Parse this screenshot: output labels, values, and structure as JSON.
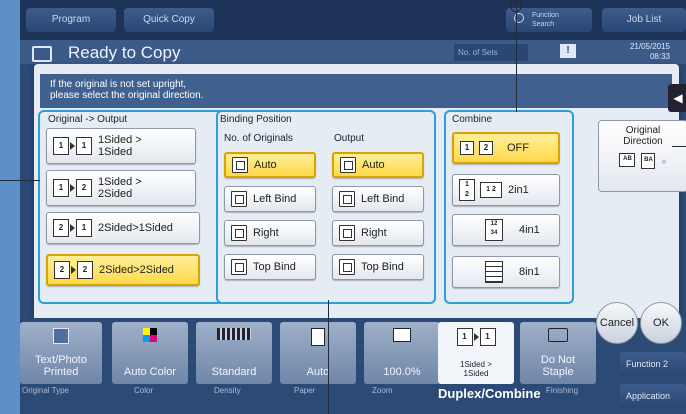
{
  "topbar": {
    "program": "Program",
    "quick_copy": "Quick Copy",
    "function_search_line1": "Function",
    "function_search_line2": "Search",
    "job_list": "Job List"
  },
  "status": {
    "title": "Ready to Copy",
    "sets_label": "No. of Sets",
    "warning": "!",
    "date": "21/05/2015",
    "time": "08:33"
  },
  "dialog": {
    "instruction_line1": "If the original is not set upright,",
    "instruction_line2": "please select the original direction.",
    "original_output": {
      "title": "Original -> Output",
      "options": [
        {
          "label": "1Sided >\n1Sided",
          "icon": "1-to-1-sided-icon",
          "selected": false
        },
        {
          "label": "1Sided >\n2Sided",
          "icon": "1-to-2-sided-icon",
          "selected": false
        },
        {
          "label": "2Sided>1Sided",
          "icon": "2-to-1-sided-icon",
          "selected": false
        },
        {
          "label": "2Sided>2Sided",
          "icon": "2-to-2-sided-icon",
          "selected": true
        }
      ]
    },
    "binding_position": {
      "title": "Binding Position",
      "originals_title": "No. of Originals",
      "output_title": "Output",
      "originals": [
        {
          "label": "Auto",
          "selected": true
        },
        {
          "label": "Left Bind",
          "selected": false
        },
        {
          "label": "Right",
          "selected": false
        },
        {
          "label": "Top Bind",
          "selected": false
        }
      ],
      "output": [
        {
          "label": "Auto",
          "selected": true
        },
        {
          "label": "Left Bind",
          "selected": false
        },
        {
          "label": "Right",
          "selected": false
        },
        {
          "label": "Top Bind",
          "selected": false
        }
      ]
    },
    "combine": {
      "title": "Combine",
      "options": [
        {
          "label": "OFF",
          "selected": true
        },
        {
          "label": "2in1",
          "selected": false
        },
        {
          "label": "4in1",
          "selected": false
        },
        {
          "label": "8in1",
          "selected": false
        }
      ]
    },
    "original_direction": {
      "line1": "Original",
      "line2": "Direction"
    }
  },
  "actions": {
    "cancel": "Cancel",
    "ok": "OK"
  },
  "bottom": {
    "tiles": [
      {
        "text": "Text/Photo\nPrinted",
        "caption": "Original Type"
      },
      {
        "text": "Auto Color",
        "caption": "Color"
      },
      {
        "text": "Standard",
        "caption": "Density"
      },
      {
        "text": "Auto",
        "caption": "Paper"
      },
      {
        "text": "100.0%",
        "caption": "Zoom"
      },
      {
        "text": "1Sided >\n1Sided",
        "caption": "Duplex/Combine"
      },
      {
        "text": "Do Not\nStaple",
        "caption": "Finishing"
      }
    ],
    "duplex_label": "Duplex/Combine",
    "function": "Function 2",
    "application": "Application"
  }
}
